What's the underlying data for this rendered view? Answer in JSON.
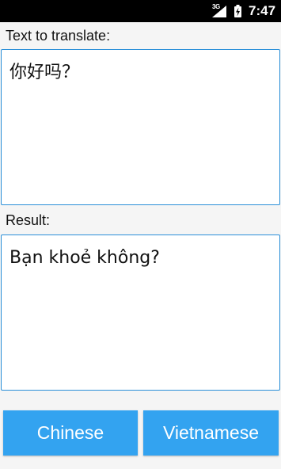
{
  "status_bar": {
    "network_type": "3G",
    "time": "7:47",
    "icons": [
      "signal-icon",
      "battery-charging-icon"
    ]
  },
  "source": {
    "label": "Text to translate:",
    "value": "你好吗？"
  },
  "result": {
    "label": "Result:",
    "value": "Bạn khoẻ không?"
  },
  "buttons": {
    "from_language": "Chinese",
    "to_language": "Vietnamese"
  },
  "colors": {
    "accent": "#33a3f0",
    "border": "#2a8fd8",
    "background": "#f5f5f5",
    "status_bar": "#000000"
  }
}
